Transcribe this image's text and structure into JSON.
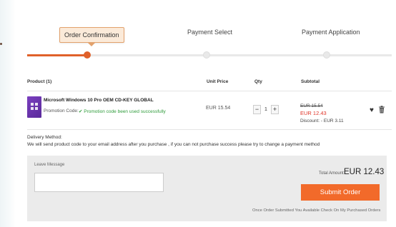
{
  "steps": [
    {
      "label": "Order Confirmation",
      "active": true
    },
    {
      "label": "Payment Select",
      "active": false
    },
    {
      "label": "Payment Application",
      "active": false
    }
  ],
  "table_header": {
    "product": "Product (1)",
    "unit_price": "Unit Price",
    "qty": "Qty",
    "subtotal": "Subtotal"
  },
  "product": {
    "name": "Microsoft Windows 10 Pro OEM CD-KEY GLOBAL",
    "promo_label": "Promotion Code:",
    "promo_status": "✔ Promotion code been used successfully",
    "unit_price": "EUR 15.54",
    "qty": "1",
    "qty_minus": "−",
    "qty_plus": "+",
    "subtotal_original": "EUR 15.54",
    "subtotal": "EUR 12.43",
    "discount": "Discount: - EUR 3.11"
  },
  "delivery": {
    "title": "Delivery Method:",
    "text": "We will send product code to your email address after you purchase , if you can not purchase success please try to change a payment method"
  },
  "order": {
    "leave_message_label": "Leave Message",
    "total_label": "Total Amount:",
    "total_value": "EUR 12.43",
    "submit_label": "Submit Order",
    "note": "Once Order Submitted You Available Check On My Purchased Orders"
  },
  "icons": {
    "heart": "heart-icon",
    "trash": "trash-icon",
    "check": "check-icon"
  },
  "colors": {
    "accent": "#e0612a",
    "button": "#f26a2a",
    "price_red": "#e0362a",
    "success_green": "#2e9b3a"
  }
}
